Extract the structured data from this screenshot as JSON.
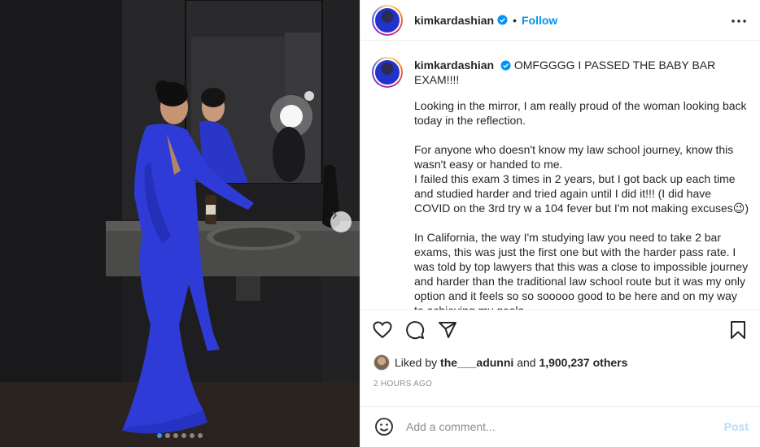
{
  "post": {
    "username": "kimkardashian",
    "bullet": "•",
    "follow_label": "Follow",
    "caption_headline": "OMFGGGG I PASSED THE BABY BAR EXAM!!!!",
    "caption_body": "Looking in the mirror, I am really proud of the woman looking back today in the reflection.\n\nFor anyone who doesn't know my law school journey, know this wasn't easy or handed to me.\nI failed this exam 3 times in 2 years, but I got back up each time and studied harder and tried again until I did it!!! (I did have COVID on the 3rd try w a 104 fever but I'm not making excuses😉)\n\nIn California, the way I'm studying law you need to take 2 bar exams, this was just the first one but with the harder pass rate. I was told by top lawyers that this was a close to impossible journey and harder than the traditional law school route but it was my only option and it feels so so sooooo good to be here and on my way to achieving my goals.",
    "likes_prefix": "Liked by",
    "liked_by_user": "the___adunni",
    "likes_and": "and",
    "likes_others": "1,900,237 others",
    "timestamp": "2 HOURS AGO",
    "comment_placeholder": "Add a comment...",
    "post_label": "Post"
  },
  "carousel": {
    "total_slides": 6,
    "active_index": 0
  },
  "icons": {
    "verified": "verified-badge-icon",
    "more": "more-options-icon",
    "like": "heart-icon",
    "comment": "comment-icon",
    "share": "share-icon",
    "save": "bookmark-icon",
    "emoji": "emoji-icon",
    "next": "chevron-right-icon"
  },
  "colors": {
    "accent": "#0095f6",
    "post_disabled": "#b3dbff",
    "gown": "#2f3bd6"
  }
}
